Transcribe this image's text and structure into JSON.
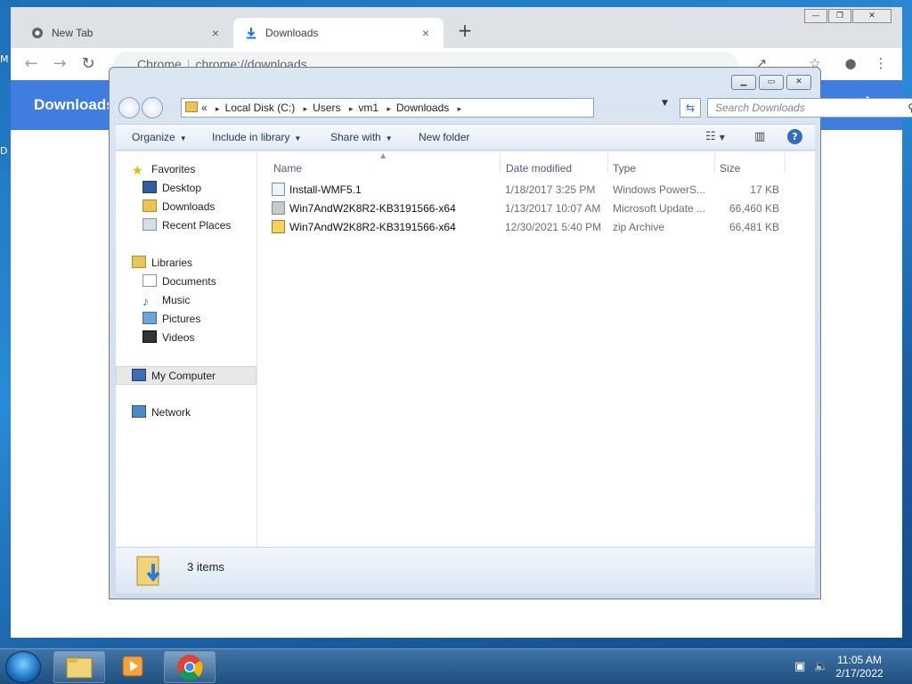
{
  "desktop": {
    "frag_top": "M",
    "frag_mid": "D"
  },
  "chrome": {
    "tabs": [
      {
        "label": "New Tab"
      },
      {
        "label": "Downloads"
      }
    ],
    "tab_close": "×",
    "new_tab": "+",
    "window_buttons": {
      "minimize": "—",
      "restore": "❐",
      "close": "✕"
    },
    "omnibox": {
      "site_label": "Chrome",
      "url": "chrome://downloads"
    },
    "page_title": "Downloads",
    "menu": "⋮"
  },
  "explorer": {
    "window_buttons": {
      "minimize": "▁",
      "maximize": "▭",
      "close": "✕"
    },
    "breadcrumb": [
      "Local Disk (C:)",
      "Users",
      "vm1",
      "Downloads"
    ],
    "breadcrumb_prefix": "«",
    "breadcrumb_sep": "▸",
    "search_placeholder": "Search Downloads",
    "commands": {
      "organize": "Organize",
      "include_in_library": "Include in library",
      "share_with": "Share with",
      "new_folder": "New folder"
    },
    "help": "?",
    "nav": {
      "favorites": "Favorites",
      "desktop": "Desktop",
      "downloads": "Downloads",
      "recent_places": "Recent Places",
      "libraries": "Libraries",
      "documents": "Documents",
      "music": "Music",
      "pictures": "Pictures",
      "videos": "Videos",
      "my_computer": "My Computer",
      "network": "Network"
    },
    "columns": {
      "name": "Name",
      "date": "Date modified",
      "type": "Type",
      "size": "Size"
    },
    "files": [
      {
        "name": "Install-WMF5.1",
        "date": "1/18/2017 3:25 PM",
        "type": "Windows PowerS...",
        "size": "17 KB"
      },
      {
        "name": "Win7AndW2K8R2-KB3191566-x64",
        "date": "1/13/2017 10:07 AM",
        "type": "Microsoft Update ...",
        "size": "66,460 KB"
      },
      {
        "name": "Win7AndW2K8R2-KB3191566-x64",
        "date": "12/30/2021 5:40 PM",
        "type": "zip Archive",
        "size": "66,481 KB"
      }
    ],
    "status_count": "3 items"
  },
  "taskbar": {
    "time": "11:05 AM",
    "date": "2/17/2022"
  },
  "colors": {
    "chrome_header": "#3f7ee0",
    "taskbar": "#2a5c8f"
  }
}
